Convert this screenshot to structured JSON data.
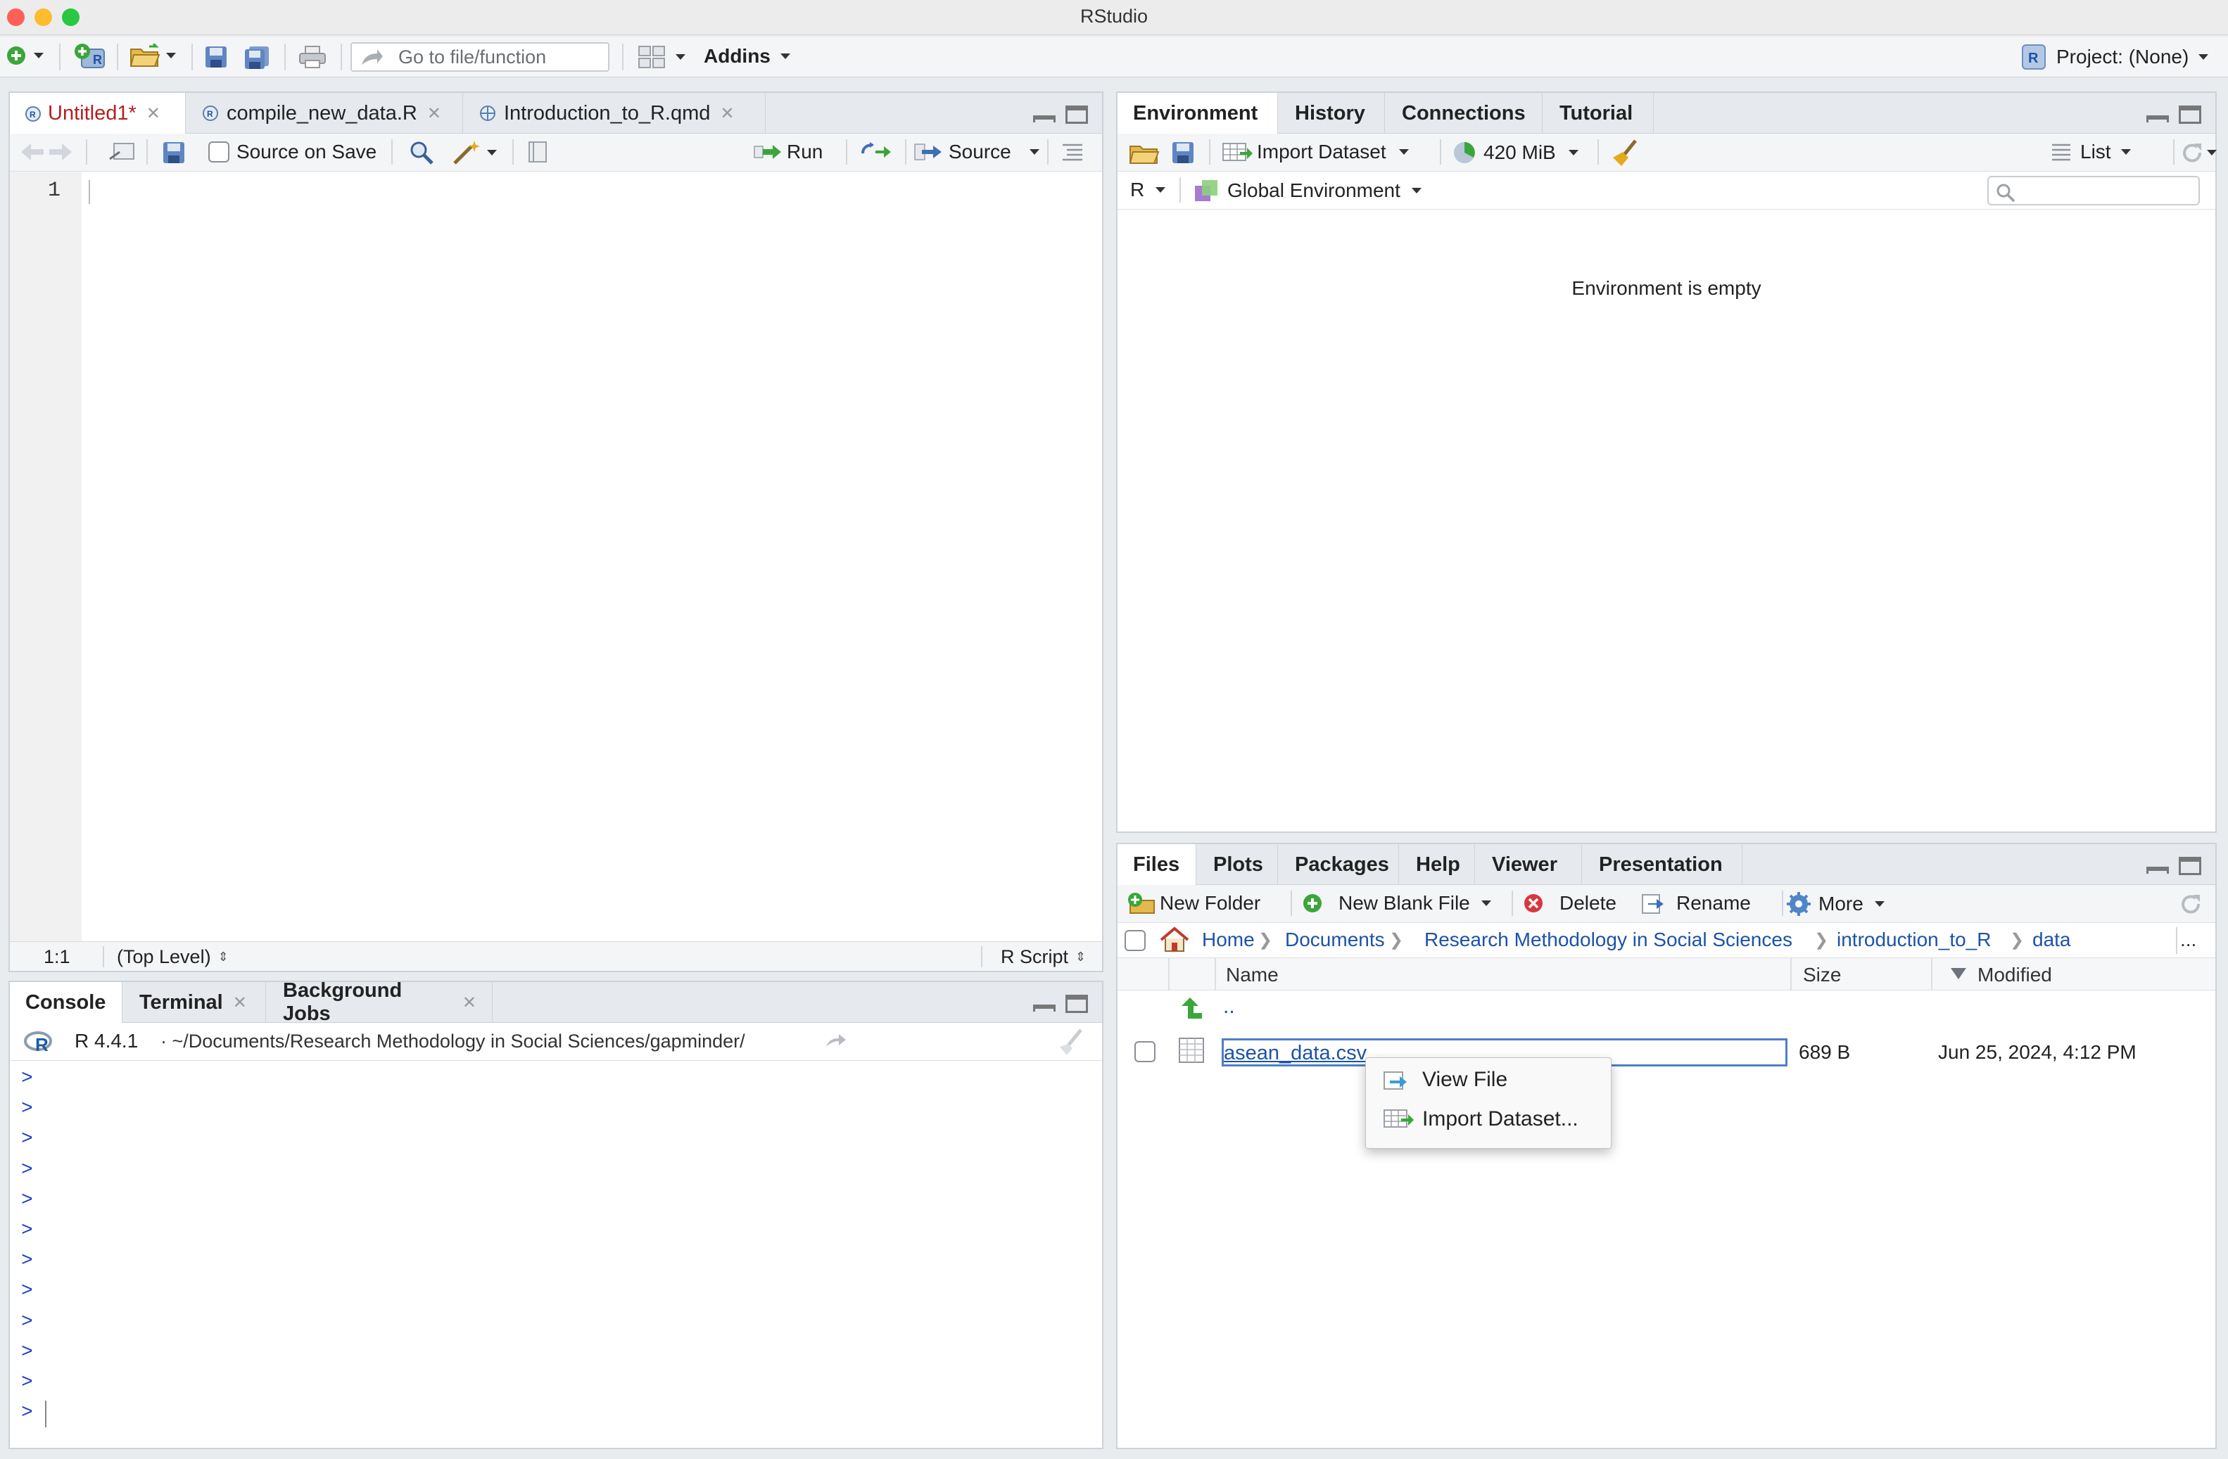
{
  "window": {
    "title": "RStudio"
  },
  "toolbar": {
    "goto_placeholder": "Go to file/function",
    "addins_label": "Addins",
    "project_label": "Project: (None)"
  },
  "source_pane": {
    "tabs": [
      {
        "label": "Untitled1*",
        "active": true
      },
      {
        "label": "compile_new_data.R",
        "active": false
      },
      {
        "label": "Introduction_to_R.qmd",
        "active": false
      }
    ],
    "source_on_save_label": "Source on Save",
    "run_label": "Run",
    "source_label": "Source",
    "line_numbers": [
      "1"
    ],
    "status": {
      "position": "1:1",
      "scope": "(Top Level)",
      "filetype": "R Script"
    }
  },
  "console_pane": {
    "tabs": [
      {
        "label": "Console",
        "active": true
      },
      {
        "label": "Terminal",
        "closable": true
      },
      {
        "label": "Background Jobs",
        "closable": true
      }
    ],
    "r_version": "R 4.4.1",
    "path": "· ~/Documents/Research Methodology in Social Sciences/gapminder/",
    "prompt_symbol": ">",
    "prompt_lines": 12
  },
  "environment_pane": {
    "tabs": [
      "Environment",
      "History",
      "Connections",
      "Tutorial"
    ],
    "import_dataset_label": "Import Dataset",
    "memory_label": "420 MiB",
    "list_label": "List",
    "language_label": "R",
    "scope_label": "Global Environment",
    "empty_message": "Environment is empty"
  },
  "files_pane": {
    "tabs": [
      "Files",
      "Plots",
      "Packages",
      "Help",
      "Viewer",
      "Presentation"
    ],
    "new_folder_label": "New Folder",
    "new_blank_file_label": "New Blank File",
    "delete_label": "Delete",
    "rename_label": "Rename",
    "more_label": "More",
    "breadcrumb": [
      "Home",
      "Documents",
      "Research Methodology in Social Sciences",
      "introduction_to_R",
      "data"
    ],
    "breadcrumb_more": "...",
    "columns": {
      "name": "Name",
      "size": "Size",
      "modified": "Modified"
    },
    "parent_dir": "..",
    "files": [
      {
        "name": "asean_data.csv",
        "size": "689 B",
        "modified": "Jun 25, 2024, 4:12 PM"
      }
    ]
  },
  "context_menu": {
    "items": [
      "View File",
      "Import Dataset..."
    ]
  },
  "colors": {
    "accent_blue": "#1d52a8",
    "console_prompt": "#1d3fc1",
    "active_tab_text": "#b51f1f",
    "close_red": "#ff5f57",
    "minimize_yellow": "#febc2e",
    "zoom_green": "#28c840"
  }
}
